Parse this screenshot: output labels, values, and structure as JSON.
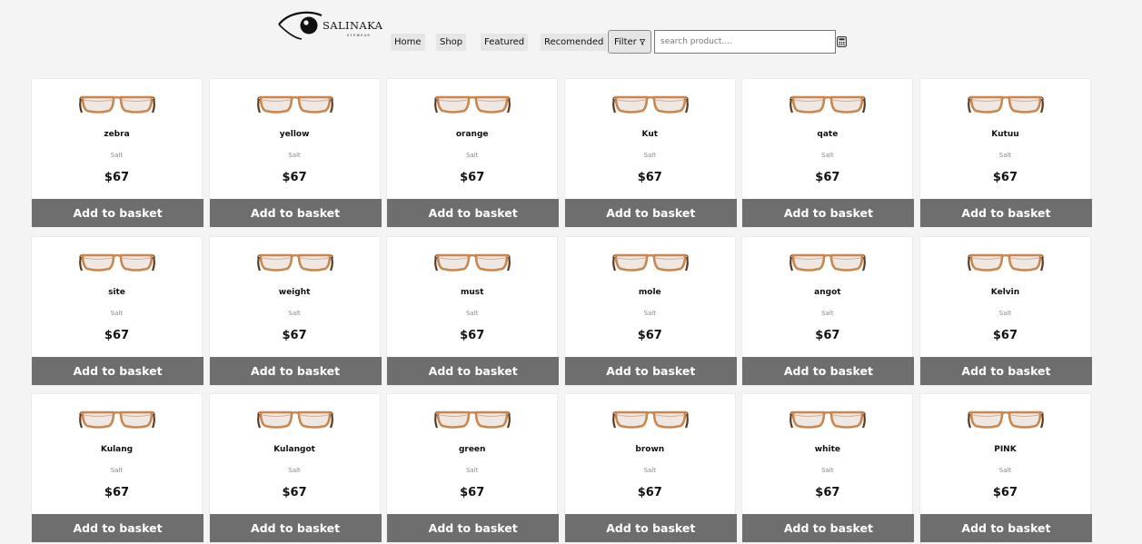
{
  "brand": {
    "name": "SALINAKA",
    "tagline": "EYEWEAR",
    "logo_icon": "eye-icon"
  },
  "nav": {
    "items": [
      {
        "label": "Home"
      },
      {
        "label": "Shop"
      },
      {
        "label": "Featured"
      },
      {
        "label": "Recomended"
      }
    ],
    "filter_label": "Filter",
    "filter_icon": "funnel-icon",
    "search_placeholder": "search product....",
    "search_value": "",
    "search_side_icon": "calculator-icon"
  },
  "colors": {
    "button_bg": "#6e6e6e",
    "page_bg": "#f4f4f4",
    "frame_color": "#c9874f"
  },
  "products": [
    {
      "name": "zebra",
      "brand": "Salt",
      "price": "$67",
      "cta": "Add to basket"
    },
    {
      "name": "yellow",
      "brand": "Salt",
      "price": "$67",
      "cta": "Add to basket"
    },
    {
      "name": "orange",
      "brand": "Salt",
      "price": "$67",
      "cta": "Add to basket"
    },
    {
      "name": "Kut",
      "brand": "Salt",
      "price": "$67",
      "cta": "Add to basket"
    },
    {
      "name": "qate",
      "brand": "Salt",
      "price": "$67",
      "cta": "Add to basket"
    },
    {
      "name": "Kutuu",
      "brand": "Salt",
      "price": "$67",
      "cta": "Add to basket"
    },
    {
      "name": "site",
      "brand": "Salt",
      "price": "$67",
      "cta": "Add to basket"
    },
    {
      "name": "weight",
      "brand": "Salt",
      "price": "$67",
      "cta": "Add to basket"
    },
    {
      "name": "must",
      "brand": "Salt",
      "price": "$67",
      "cta": "Add to basket"
    },
    {
      "name": "mole",
      "brand": "Salt",
      "price": "$67",
      "cta": "Add to basket"
    },
    {
      "name": "angot",
      "brand": "Salt",
      "price": "$67",
      "cta": "Add to basket"
    },
    {
      "name": "Kelvin",
      "brand": "Salt",
      "price": "$67",
      "cta": "Add to basket"
    },
    {
      "name": "Kulang",
      "brand": "Salt",
      "price": "$67",
      "cta": "Add to basket"
    },
    {
      "name": "Kulangot",
      "brand": "Salt",
      "price": "$67",
      "cta": "Add to basket"
    },
    {
      "name": "green",
      "brand": "Salt",
      "price": "$67",
      "cta": "Add to basket"
    },
    {
      "name": "brown",
      "brand": "Salt",
      "price": "$67",
      "cta": "Add to basket"
    },
    {
      "name": "white",
      "brand": "Salt",
      "price": "$67",
      "cta": "Add to basket"
    },
    {
      "name": "PINK",
      "brand": "Salt",
      "price": "$67",
      "cta": "Add to basket"
    }
  ]
}
